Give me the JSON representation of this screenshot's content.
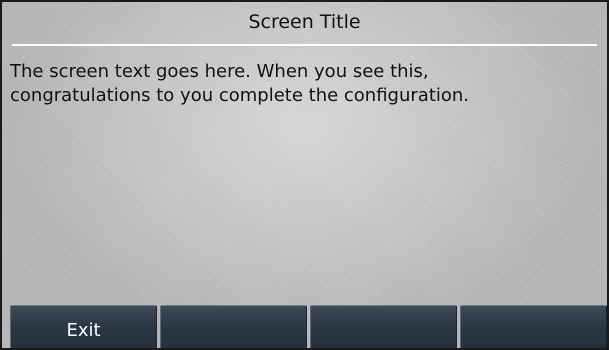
{
  "screen": {
    "title": "Screen Title",
    "text_line_1": "The screen text goes here. When you see this,",
    "text_line_2": "congratulations to you complete the configuration."
  },
  "softkeys": [
    {
      "label": "Exit"
    },
    {
      "label": ""
    },
    {
      "label": ""
    },
    {
      "label": ""
    }
  ]
}
